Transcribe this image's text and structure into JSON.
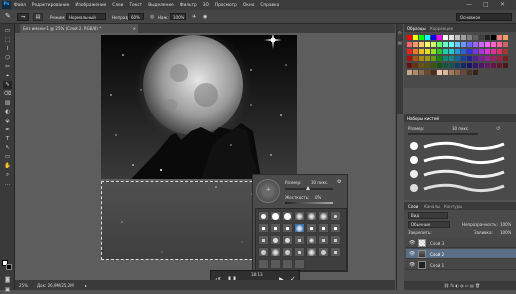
{
  "app": {
    "logo": "Ps",
    "window_controls": [
      "—",
      "□",
      "✕"
    ]
  },
  "menu": [
    "Файл",
    "Редактирование",
    "Изображение",
    "Слои",
    "Текст",
    "Выделение",
    "Фильтр",
    "3D",
    "Просмотр",
    "Окно",
    "Справка"
  ],
  "options": {
    "mode_label": "Режим:",
    "mode_value": "Нормальный",
    "opacity_label": "Непрозр.:",
    "opacity_value": "60%",
    "flow_label": "Наж.:",
    "flow_value": "100%",
    "workspace": "Основное"
  },
  "document": {
    "tab_title": "Без имени-1 @ 25% (Слой 2, RGB/8) *",
    "tab_close": "×"
  },
  "status": {
    "zoom": "25%",
    "doc_size": "Док: 26,9M/25,2M",
    "arrow": "▸"
  },
  "swatches_panel": {
    "tab_active": "Образцы",
    "tab_inactive": "Коррекция"
  },
  "brush_presets": {
    "title": "Наборы кистей",
    "size_label": "Размер:",
    "size_value": "30 пикс."
  },
  "layers_panel": {
    "tabs": [
      "Слои",
      "Каналы",
      "Контуры"
    ],
    "kind_label": "Вид",
    "blend_mode": "Обычные",
    "opacity_label": "Непрозрачность:",
    "opacity_value": "100%",
    "lock_label": "Закрепить:",
    "fill_label": "Заливка:",
    "fill_value": "100%",
    "layers": [
      "Слой 3",
      "Слой 2",
      "Слой 1"
    ],
    "footer_icons": "⛓ fx ◐ ◍ ▭ ▤ 🗑"
  },
  "brush_popup": {
    "size_label": "Размер:",
    "size_value": "30 пикс.",
    "hardness_label": "Жесткость:",
    "hardness_value": "0%",
    "menu_icon": "⚙"
  },
  "playback": {
    "time": "18:13",
    "buttons": [
      "↺",
      "❚❚",
      "▶",
      "✓"
    ]
  },
  "tools": [
    "▭",
    "⬚",
    "⌇",
    "⬡",
    "✂",
    "⌖",
    "✎",
    "⌫",
    "▨",
    "◐",
    "⬙",
    "✒",
    "T",
    "↖",
    "▭",
    "✋",
    "⌕",
    "…"
  ],
  "colors": {
    "accent": "#31a8ff",
    "panel": "#535353",
    "dark": "#3a3a3a"
  }
}
